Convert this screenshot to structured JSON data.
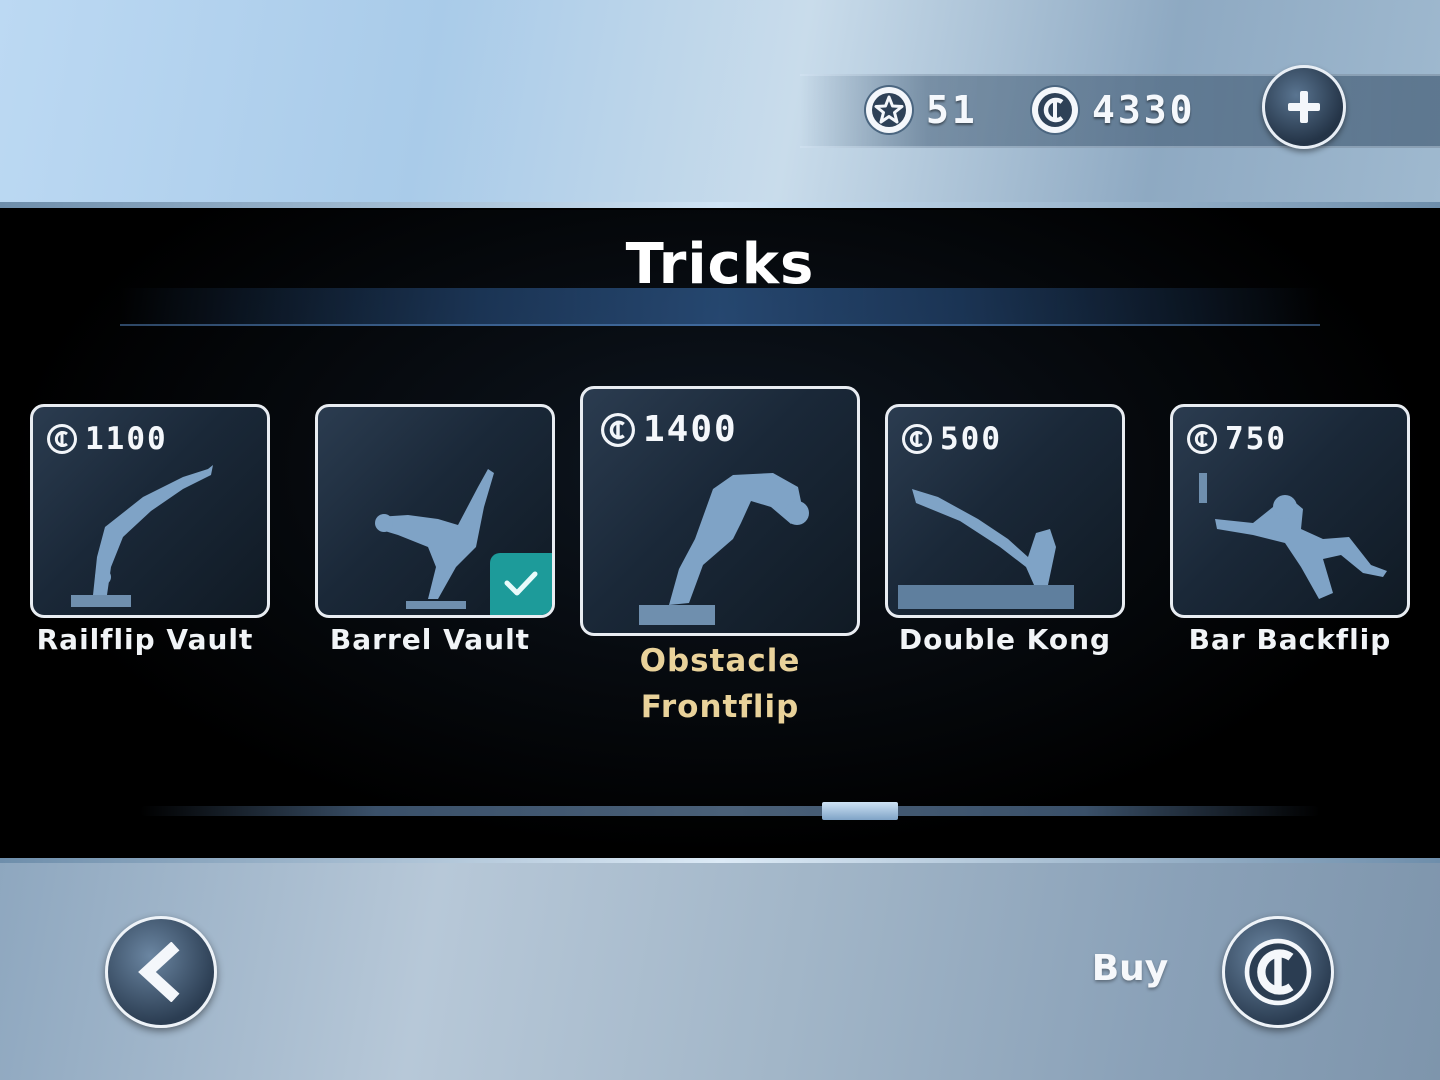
{
  "header": {
    "stars": "51",
    "coins": "4330",
    "add_currency_icon": "plus-icon"
  },
  "title": "Tricks",
  "tricks": [
    {
      "name": "Railflip Vault",
      "price": "1100",
      "owned": false,
      "selected": false
    },
    {
      "name": "Barrel Vault",
      "price": "",
      "owned": true,
      "selected": false
    },
    {
      "name": "Obstacle\nFrontflip",
      "name_line1": "Obstacle",
      "name_line2": "Frontflip",
      "price": "1400",
      "owned": false,
      "selected": true
    },
    {
      "name": "Double Kong",
      "price": "500",
      "owned": false,
      "selected": false
    },
    {
      "name": "Bar Backflip",
      "price": "750",
      "owned": false,
      "selected": false
    }
  ],
  "footer": {
    "buy_label": "Buy",
    "back_icon": "chevron-left-icon",
    "buy_icon": "coin-icon"
  },
  "colors": {
    "selected_label": "#e9d29a",
    "owned_badge": "#1d9b9a",
    "silhouette": "#7fa3c6"
  }
}
